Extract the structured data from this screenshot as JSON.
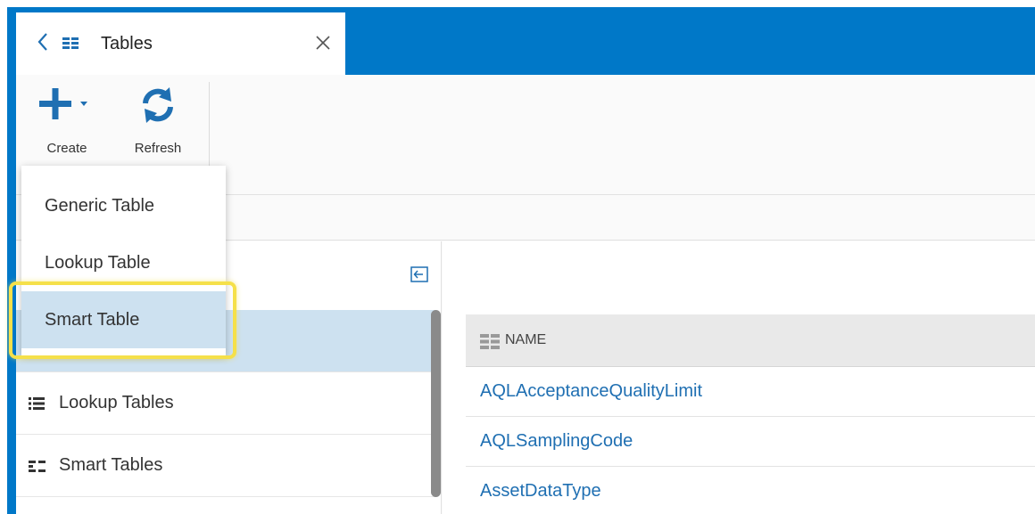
{
  "tab": {
    "title": "Tables",
    "icons": [
      "chevron-left-icon",
      "grid-icon",
      "close-icon"
    ]
  },
  "toolbar": {
    "create_label": "Create",
    "refresh_label": "Refresh"
  },
  "create_menu": {
    "items": [
      {
        "label": "Generic Table"
      },
      {
        "label": "Lookup Table"
      },
      {
        "label": "Smart Table"
      }
    ],
    "selected": "Smart Table"
  },
  "nav": {
    "items": [
      {
        "label": "Lookup Tables",
        "icon": "list-icon"
      },
      {
        "label": "Smart Tables",
        "icon": "smart-list-icon"
      }
    ]
  },
  "table": {
    "column_header": "NAME",
    "rows": [
      "AQLAcceptanceQualityLimit",
      "AQLSamplingCode",
      "AssetDataType"
    ]
  },
  "colors": {
    "accent": "#0078c8",
    "selected": "#cde1f0",
    "highlight": "#f5e04a",
    "link": "#1f6fb2"
  }
}
